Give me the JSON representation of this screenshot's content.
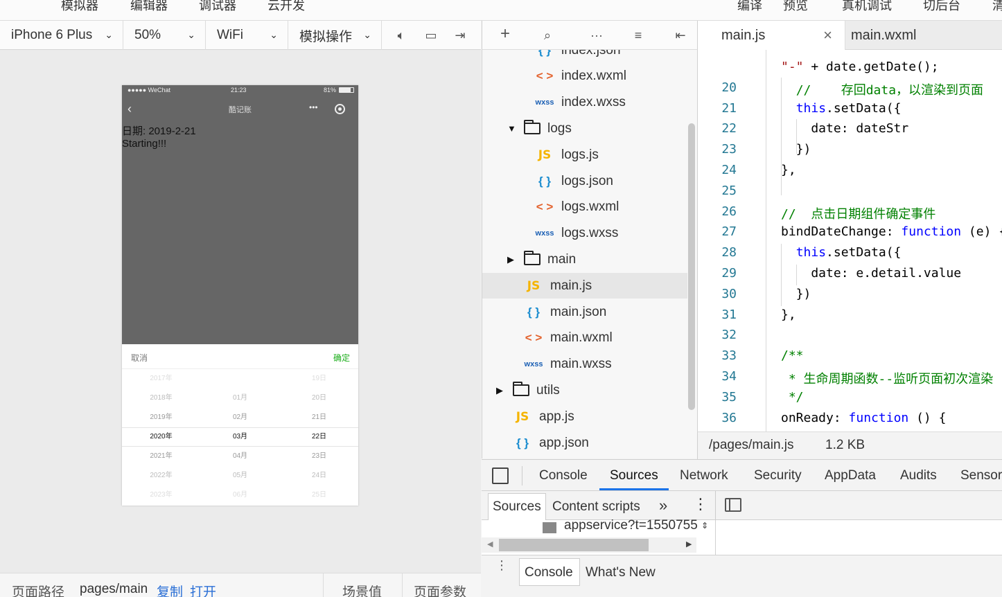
{
  "menubar": {
    "items": [
      "模拟器",
      "编辑器",
      "调试器",
      "云开发",
      "编译",
      "预览",
      "真机调试",
      "切后台",
      "清"
    ]
  },
  "simulator": {
    "device": "iPhone 6 Plus",
    "zoom": "50%",
    "network": "WiFi",
    "operation": "模拟操作"
  },
  "phone": {
    "status_carrier": "●●●●● WeChat",
    "status_time": "21:23",
    "status_battery": "81%",
    "nav_title": "酷记账",
    "date_line": "日期: 2019-2-21",
    "starting_line": "Starting!!!",
    "picker_cancel": "取消",
    "picker_confirm": "确定",
    "years": [
      "2017年",
      "2018年",
      "2019年",
      "2020年",
      "2021年",
      "2022年",
      "2023年"
    ],
    "months": [
      "",
      "01月",
      "02月",
      "03月",
      "04月",
      "05月",
      "06月"
    ],
    "days": [
      "19日",
      "20日",
      "21日",
      "22日",
      "23日",
      "24日",
      "25日"
    ]
  },
  "bottombar": {
    "path_label": "页面路径",
    "path_value": "pages/main",
    "copy": "复制",
    "open": "打开",
    "scene": "场景值",
    "params": "页面参数"
  },
  "tree": {
    "items": [
      {
        "kind": "json",
        "name": "index.json",
        "icon": "{ }"
      },
      {
        "kind": "wxml",
        "name": "index.wxml",
        "icon": "< >"
      },
      {
        "kind": "wxss",
        "name": "index.wxss",
        "icon": "wxss"
      },
      {
        "kind": "folder-open",
        "name": "logs",
        "icon": "▼"
      },
      {
        "kind": "js",
        "name": "logs.js",
        "icon": "JS"
      },
      {
        "kind": "json",
        "name": "logs.json",
        "icon": "{ }"
      },
      {
        "kind": "wxml",
        "name": "logs.wxml",
        "icon": "< >"
      },
      {
        "kind": "wxss",
        "name": "logs.wxss",
        "icon": "wxss"
      },
      {
        "kind": "folder",
        "name": "main",
        "icon": "▶"
      },
      {
        "kind": "js",
        "name": "main.js",
        "icon": "JS"
      },
      {
        "kind": "json",
        "name": "main.json",
        "icon": "{ }"
      },
      {
        "kind": "wxml",
        "name": "main.wxml",
        "icon": "< >"
      },
      {
        "kind": "wxss",
        "name": "main.wxss",
        "icon": "wxss"
      },
      {
        "kind": "folder",
        "name": "utils",
        "icon": "▶"
      },
      {
        "kind": "js",
        "name": "app.js",
        "icon": "JS"
      },
      {
        "kind": "json",
        "name": "app.json",
        "icon": "{ }"
      }
    ]
  },
  "editor": {
    "tab_active": "main.js",
    "tab_other": "main.wxml",
    "close": "×",
    "lines": [
      {
        "n": "",
        "html": "<span class=\"st\">\"-\"</span> + date.getDate();"
      },
      {
        "n": "20",
        "html": "  <span class=\"cm\">//    存回data，以渲染到页面</span>"
      },
      {
        "n": "21",
        "html": "  <span class=\"kw\">this</span>.setData({"
      },
      {
        "n": "22",
        "html": "    date: dateStr"
      },
      {
        "n": "23",
        "html": "  })"
      },
      {
        "n": "24",
        "html": "},"
      },
      {
        "n": "25",
        "html": ""
      },
      {
        "n": "26",
        "html": "<span class=\"cm\">//  点击日期组件确定事件</span>"
      },
      {
        "n": "27",
        "html": "bindDateChange: <span class=\"kw\">function</span> (e) {"
      },
      {
        "n": "28",
        "html": "  <span class=\"kw\">this</span>.setData({"
      },
      {
        "n": "29",
        "html": "    date: e.detail.value"
      },
      {
        "n": "30",
        "html": "  })"
      },
      {
        "n": "31",
        "html": "},"
      },
      {
        "n": "32",
        "html": ""
      },
      {
        "n": "33",
        "html": "<span class=\"cm\">/**</span>"
      },
      {
        "n": "34",
        "html": "<span class=\"cm\"> * 生命周期函数--监听页面初次渲染</span>"
      },
      {
        "n": "35",
        "html": "<span class=\"cm\"> */</span>"
      },
      {
        "n": "36",
        "html": "onReady: <span class=\"kw\">function</span> () {"
      }
    ],
    "file_path": "/pages/main.js",
    "file_size": "1.2 KB"
  },
  "devtools": {
    "tabs": [
      "Console",
      "Sources",
      "Network",
      "Security",
      "AppData",
      "Audits",
      "Sensor"
    ],
    "active_tab": "Sources",
    "subtabs": [
      "Sources",
      "Content scripts"
    ],
    "more": "»",
    "navigator_item": "appservice?t=1550755",
    "drawer_tabs": [
      "Console",
      "What's New"
    ]
  }
}
